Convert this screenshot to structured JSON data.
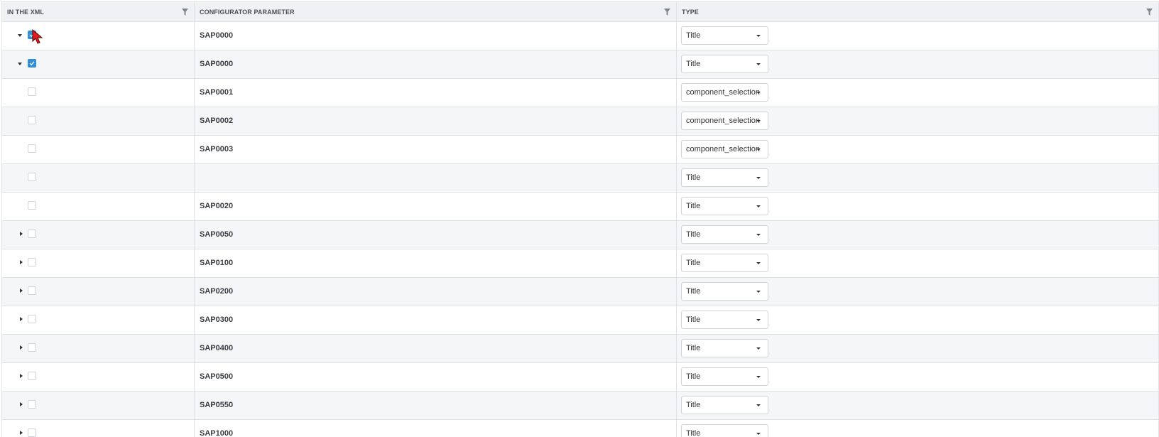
{
  "columns": [
    {
      "label": "IN THE XML",
      "filter_icon": "filter-icon"
    },
    {
      "label": "CONFIGURATOR PARAMETER",
      "filter_icon": "filter-icon"
    },
    {
      "label": "TYPE",
      "filter_icon": "filter-icon"
    }
  ],
  "rows": [
    {
      "expander": "expanded",
      "checked": true,
      "param": "SAP0000",
      "type": "Title"
    },
    {
      "expander": "expanded",
      "checked": true,
      "param": "SAP0000",
      "type": "Title"
    },
    {
      "expander": "none",
      "checked": false,
      "param": "SAP0001",
      "type": "component_selection"
    },
    {
      "expander": "none",
      "checked": false,
      "param": "SAP0002",
      "type": "component_selection"
    },
    {
      "expander": "none",
      "checked": false,
      "param": "SAP0003",
      "type": "component_selection"
    },
    {
      "expander": "none",
      "checked": false,
      "param": "",
      "type": "Title"
    },
    {
      "expander": "none",
      "checked": false,
      "param": "SAP0020",
      "type": "Title"
    },
    {
      "expander": "collapsed",
      "checked": false,
      "param": "SAP0050",
      "type": "Title"
    },
    {
      "expander": "collapsed",
      "checked": false,
      "param": "SAP0100",
      "type": "Title"
    },
    {
      "expander": "collapsed",
      "checked": false,
      "param": "SAP0200",
      "type": "Title"
    },
    {
      "expander": "collapsed",
      "checked": false,
      "param": "SAP0300",
      "type": "Title"
    },
    {
      "expander": "collapsed",
      "checked": false,
      "param": "SAP0400",
      "type": "Title"
    },
    {
      "expander": "collapsed",
      "checked": false,
      "param": "SAP0500",
      "type": "Title"
    },
    {
      "expander": "collapsed",
      "checked": false,
      "param": "SAP0550",
      "type": "Title"
    },
    {
      "expander": "collapsed",
      "checked": false,
      "param": "SAP1000",
      "type": "Title"
    }
  ],
  "colors": {
    "checkbox_checked": "#2f8fd8",
    "header_bg": "#f0f1f4",
    "alt_row_bg": "#f5f6f8",
    "cursor": "#e02020"
  }
}
